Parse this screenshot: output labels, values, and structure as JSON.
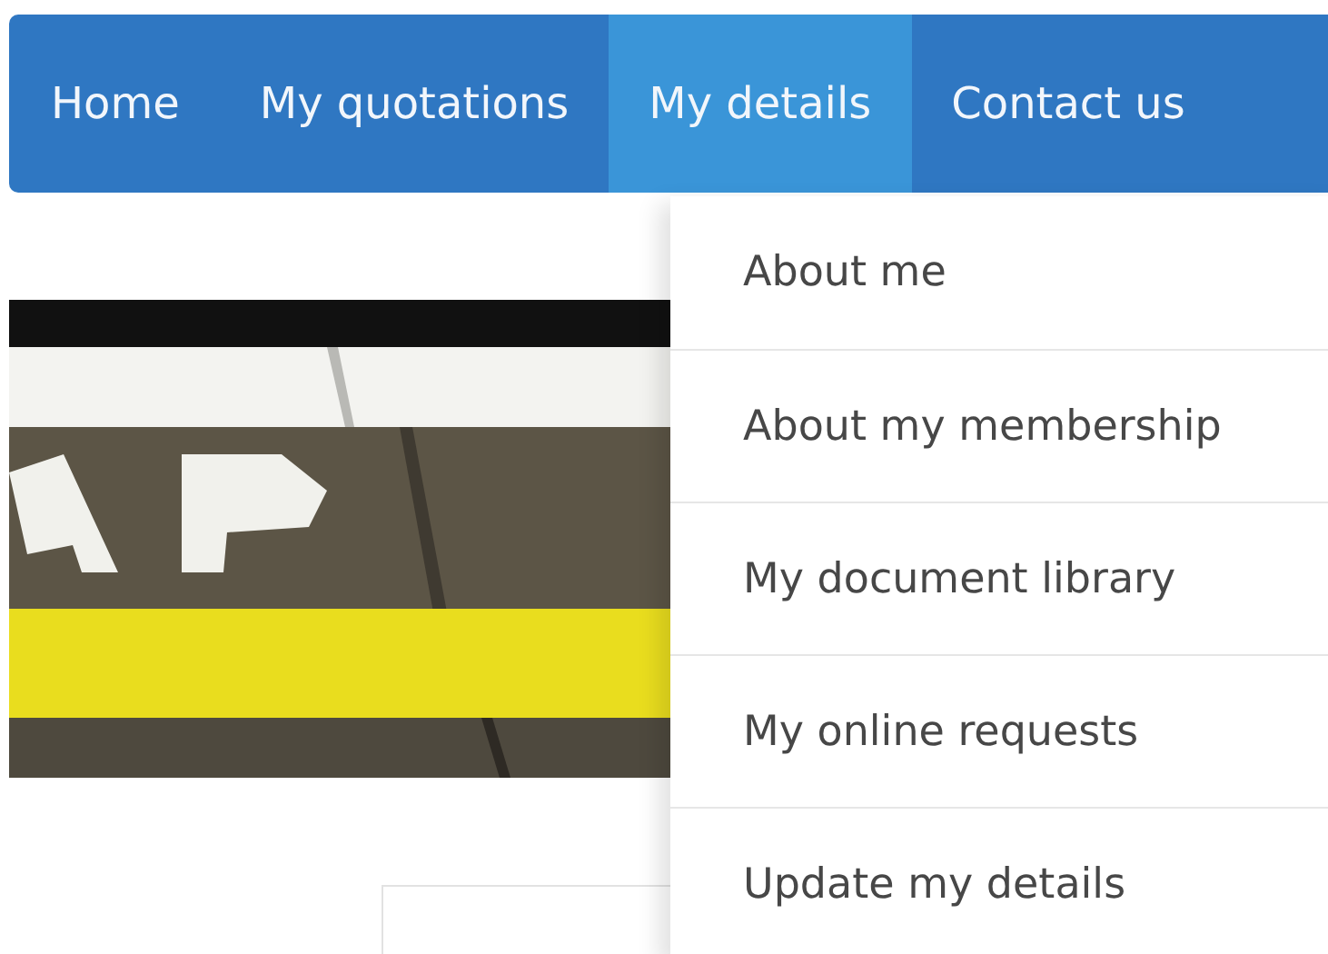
{
  "nav": {
    "tabs": [
      {
        "label": "Home",
        "selected": false
      },
      {
        "label": "My quotations",
        "selected": false
      },
      {
        "label": "My details",
        "selected": true
      },
      {
        "label": "Contact us",
        "selected": false
      }
    ]
  },
  "dropdown": {
    "items": [
      "About me",
      "About my membership",
      "My document library",
      "My online requests",
      "Update my details"
    ]
  }
}
